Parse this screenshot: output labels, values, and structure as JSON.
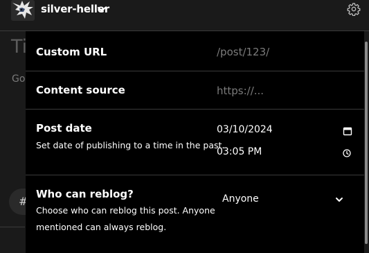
{
  "header": {
    "blog_name": "silver-heller"
  },
  "editor": {
    "title_placeholder": "Ti",
    "body_placeholder": "Go",
    "tag_symbol": "#"
  },
  "settings": {
    "custom_url": {
      "label": "Custom URL",
      "placeholder": "/post/123/"
    },
    "content_source": {
      "label": "Content source",
      "placeholder": "https://..."
    },
    "post_date": {
      "label": "Post date",
      "description": "Set date of publishing to a time in the past.",
      "date_value": "03/10/2024",
      "time_value": "03:05 PM"
    },
    "reblog": {
      "label": "Who can reblog?",
      "description_line1": "Choose who can reblog this post. Anyone",
      "description_line2": "mentioned can always reblog.",
      "selected": "Anyone"
    }
  },
  "icons": {
    "blog_dropdown": "chevron-down-icon",
    "settings": "gear-icon",
    "date_picker": "calendar-icon",
    "time_picker": "clock-icon",
    "reblog_dropdown": "chevron-down-icon"
  }
}
